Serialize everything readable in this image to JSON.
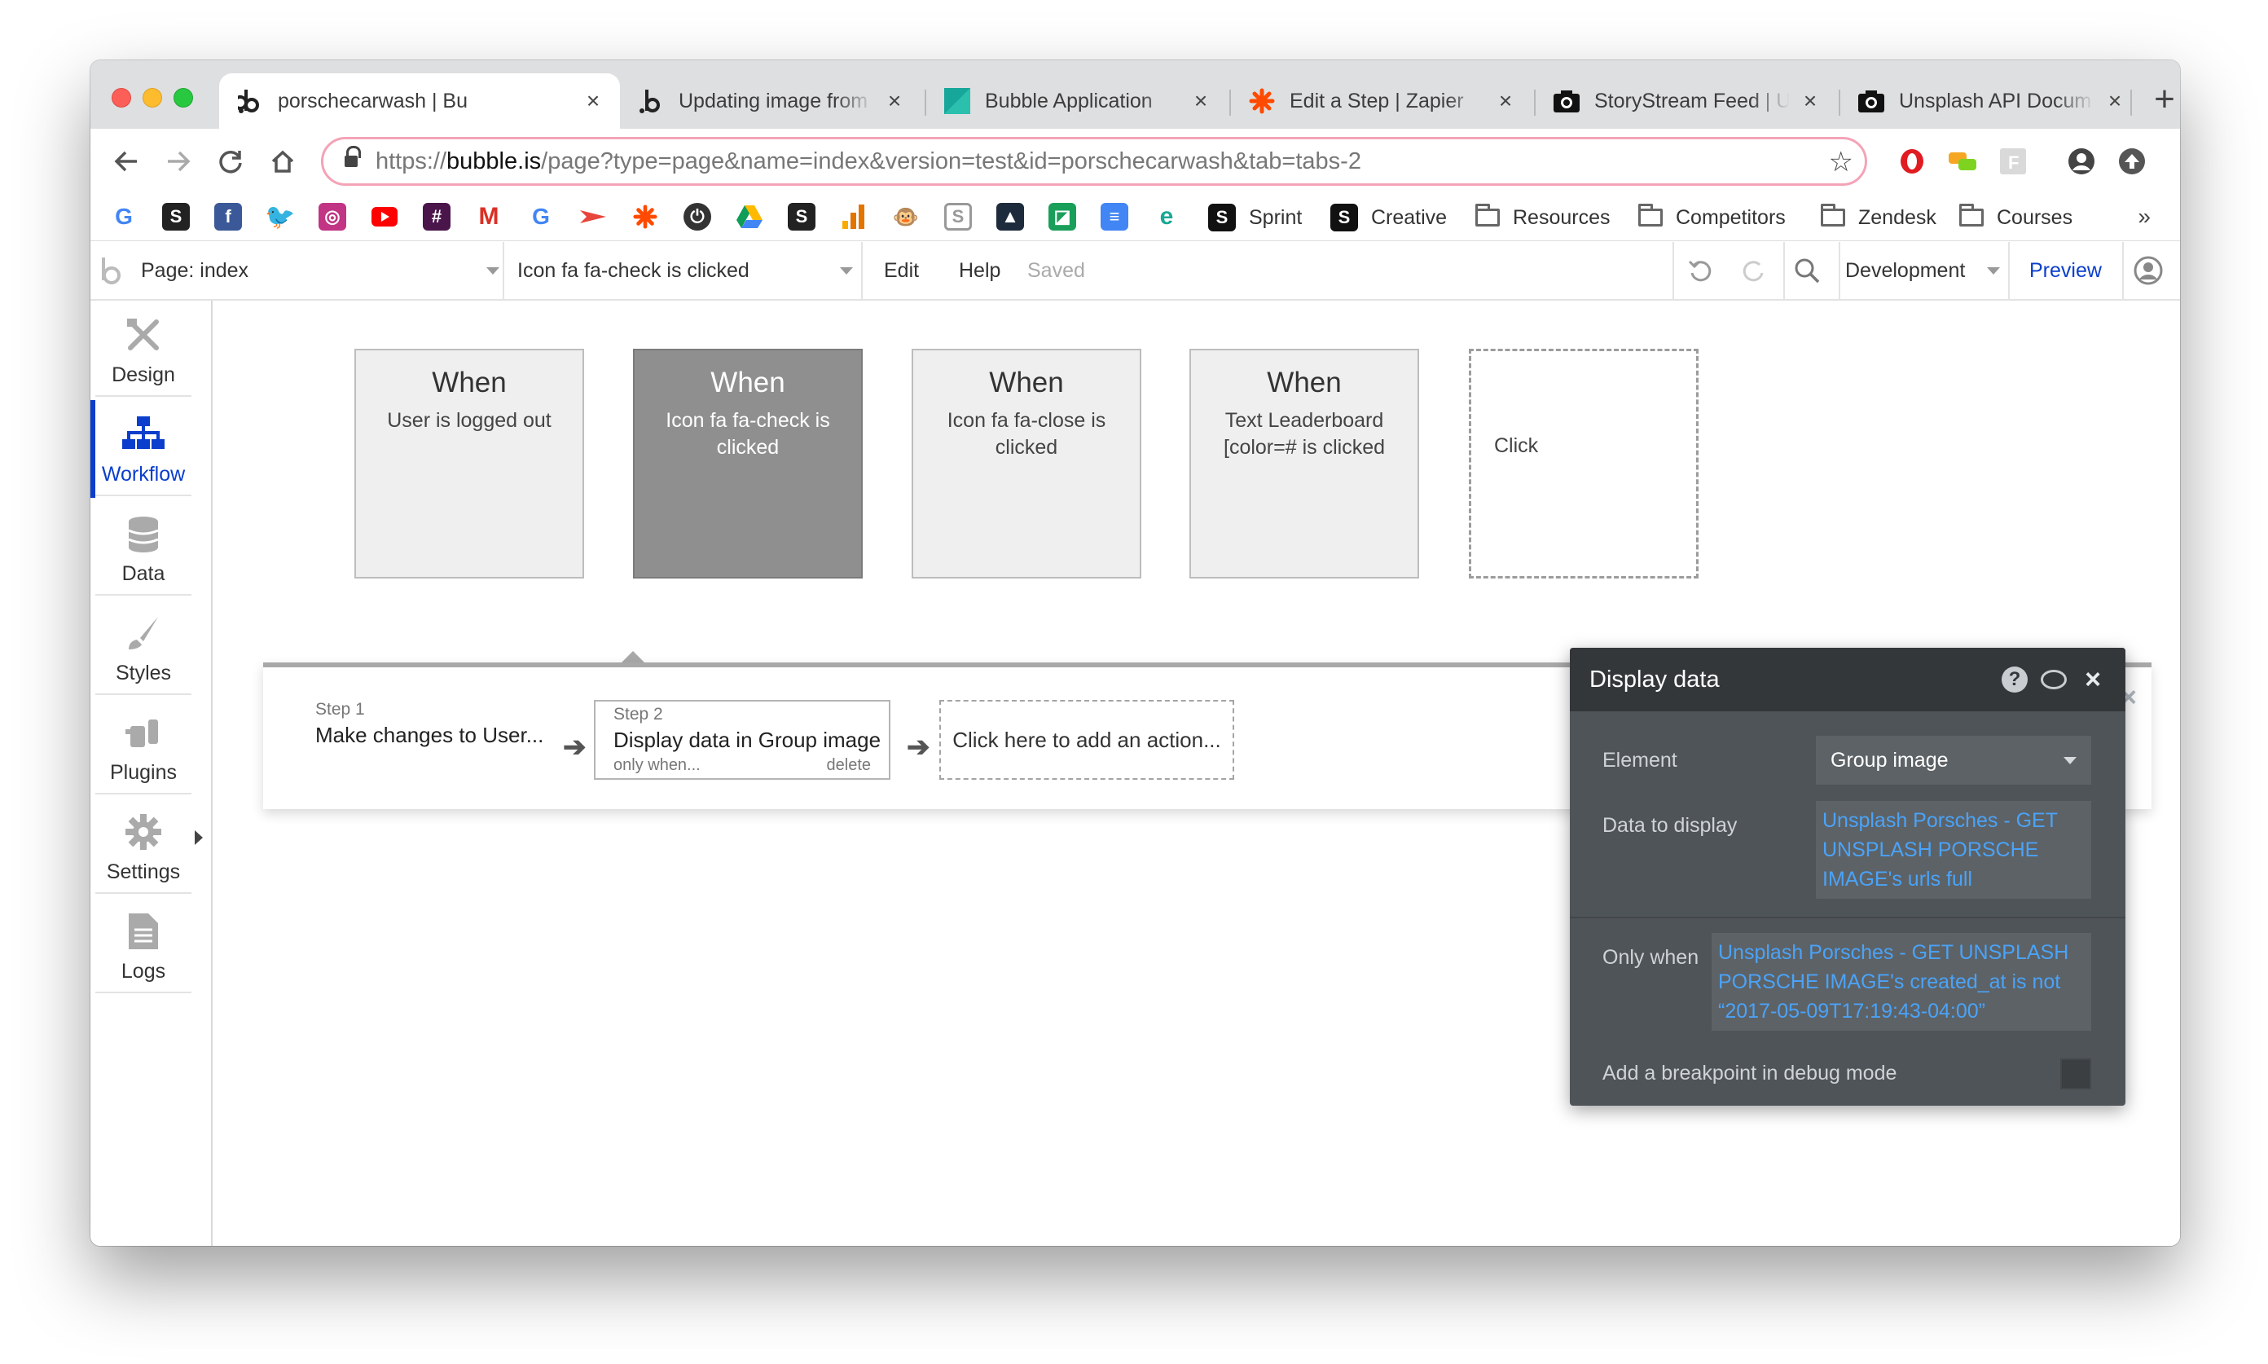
{
  "browser": {
    "tabs": [
      {
        "title": "porschecarwash | Bu",
        "favicon": "bubble-b-icon",
        "active": true
      },
      {
        "title": "Updating image from",
        "favicon": "bubble-b-icon"
      },
      {
        "title": "Bubble Application",
        "favicon": "teal-square-icon"
      },
      {
        "title": "Edit a Step | Zapier",
        "favicon": "zapier-asterisk-icon"
      },
      {
        "title": "StoryStream Feed | U",
        "favicon": "camera-icon"
      },
      {
        "title": "Unsplash API Docum",
        "favicon": "camera-icon"
      }
    ],
    "tab_close": "×",
    "new_tab": "+",
    "url": {
      "protocol": "https://",
      "host": "bubble.is",
      "path": "/page?type=page&name=index&version=test&id=porschecarwash&tab=tabs-2"
    },
    "bookmarks": [
      {
        "label": "Sprint",
        "icon": "s-square-icon"
      },
      {
        "label": "Creative",
        "icon": "s-square-icon"
      },
      {
        "label": "Resources",
        "icon": "folder-icon"
      },
      {
        "label": "Competitors",
        "icon": "folder-icon"
      },
      {
        "label": "Zendesk",
        "icon": "folder-icon"
      },
      {
        "label": "Courses",
        "icon": "folder-icon"
      }
    ],
    "bookmarks_more": "»"
  },
  "editor": {
    "page_label": "Page: index",
    "event_label": "Icon fa fa-check is clicked",
    "menu": {
      "edit": "Edit",
      "help": "Help",
      "status": "Saved"
    },
    "version": "Development",
    "preview": "Preview"
  },
  "sidebar": {
    "items": [
      {
        "label": "Design",
        "icon": "design-tools-icon"
      },
      {
        "label": "Workflow",
        "icon": "workflow-tree-icon",
        "active": true
      },
      {
        "label": "Data",
        "icon": "database-icon"
      },
      {
        "label": "Styles",
        "icon": "brush-icon"
      },
      {
        "label": "Plugins",
        "icon": "plug-icon"
      },
      {
        "label": "Settings",
        "icon": "gear-icon"
      },
      {
        "label": "Logs",
        "icon": "document-icon"
      }
    ]
  },
  "events": [
    {
      "title": "When",
      "desc": "User is logged out"
    },
    {
      "title": "When",
      "desc": "Icon fa fa-check is clicked",
      "selected": true
    },
    {
      "title": "When",
      "desc": "Icon fa fa-close is clicked"
    },
    {
      "title": "When",
      "desc": "Text Leaderboard [color=# is clicked"
    },
    {
      "title": "",
      "desc": "Click"
    }
  ],
  "actions": {
    "step1": {
      "num": "Step 1",
      "text": "Make changes to User..."
    },
    "step2": {
      "num": "Step 2",
      "text": "Display data in Group image",
      "only_when": "only when...",
      "delete": "delete"
    },
    "add_action": "Click here to add an action...",
    "close": "×"
  },
  "property_editor": {
    "title": "Display data",
    "help": "?",
    "close": "×",
    "element_label": "Element",
    "element_value": "Group image",
    "data_label": "Data to display",
    "data_value": "Unsplash Porsches - GET UNSPLASH PORSCHE IMAGE's urls full",
    "only_when_label": "Only when",
    "only_when_value": "Unsplash Porsches - GET UNSPLASH PORSCHE IMAGE's created_at is not “2017-05-09T17:19:43-04:00”",
    "breakpoint_label": "Add a breakpoint in debug mode",
    "breakpoint_checked": false,
    "link_color": "#4aa3f8"
  }
}
